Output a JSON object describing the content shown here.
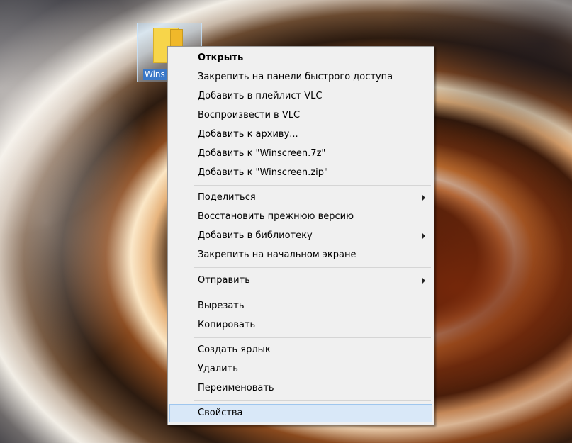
{
  "desktop": {
    "icon_label": "Wins"
  },
  "menu": {
    "open": "Открыть",
    "pin_quick_access": "Закрепить на панели быстрого доступа",
    "add_vlc_playlist": "Добавить в плейлист VLC",
    "play_vlc": "Воспроизвести в VLC",
    "add_archive": "Добавить к архиву...",
    "add_7z": "Добавить к \"Winscreen.7z\"",
    "add_zip": "Добавить к \"Winscreen.zip\"",
    "share": "Поделиться",
    "restore_version": "Восстановить прежнюю версию",
    "add_library": "Добавить в библиотеку",
    "pin_start": "Закрепить на начальном экране",
    "send_to": "Отправить",
    "cut": "Вырезать",
    "copy": "Копировать",
    "create_shortcut": "Создать ярлык",
    "delete": "Удалить",
    "rename": "Переименовать",
    "properties": "Свойства"
  }
}
